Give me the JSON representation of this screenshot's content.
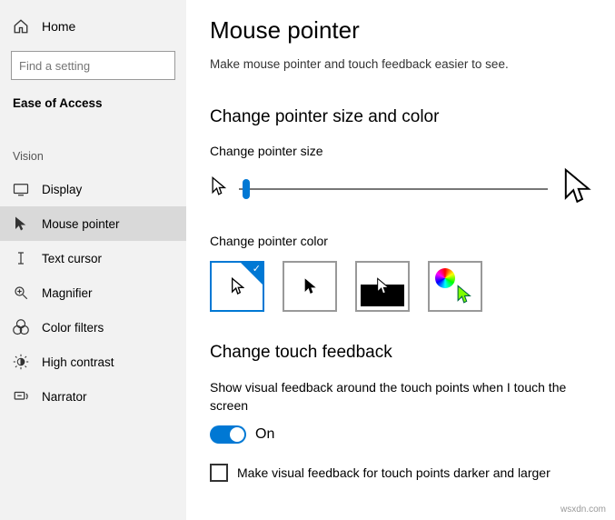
{
  "sidebar": {
    "home": "Home",
    "search_placeholder": "Find a setting",
    "category": "Ease of Access",
    "group": "Vision",
    "items": [
      {
        "label": "Display"
      },
      {
        "label": "Mouse pointer"
      },
      {
        "label": "Text cursor"
      },
      {
        "label": "Magnifier"
      },
      {
        "label": "Color filters"
      },
      {
        "label": "High contrast"
      },
      {
        "label": "Narrator"
      }
    ]
  },
  "main": {
    "title": "Mouse pointer",
    "intro": "Make mouse pointer and touch feedback easier to see.",
    "section_size": "Change pointer size and color",
    "size_label": "Change pointer size",
    "color_label": "Change pointer color",
    "section_touch": "Change touch feedback",
    "touch_desc": "Show visual feedback around the touch points when I touch the screen",
    "toggle_state": "On",
    "check_label": "Make visual feedback for touch points darker and larger"
  },
  "watermark": "wsxdn.com"
}
